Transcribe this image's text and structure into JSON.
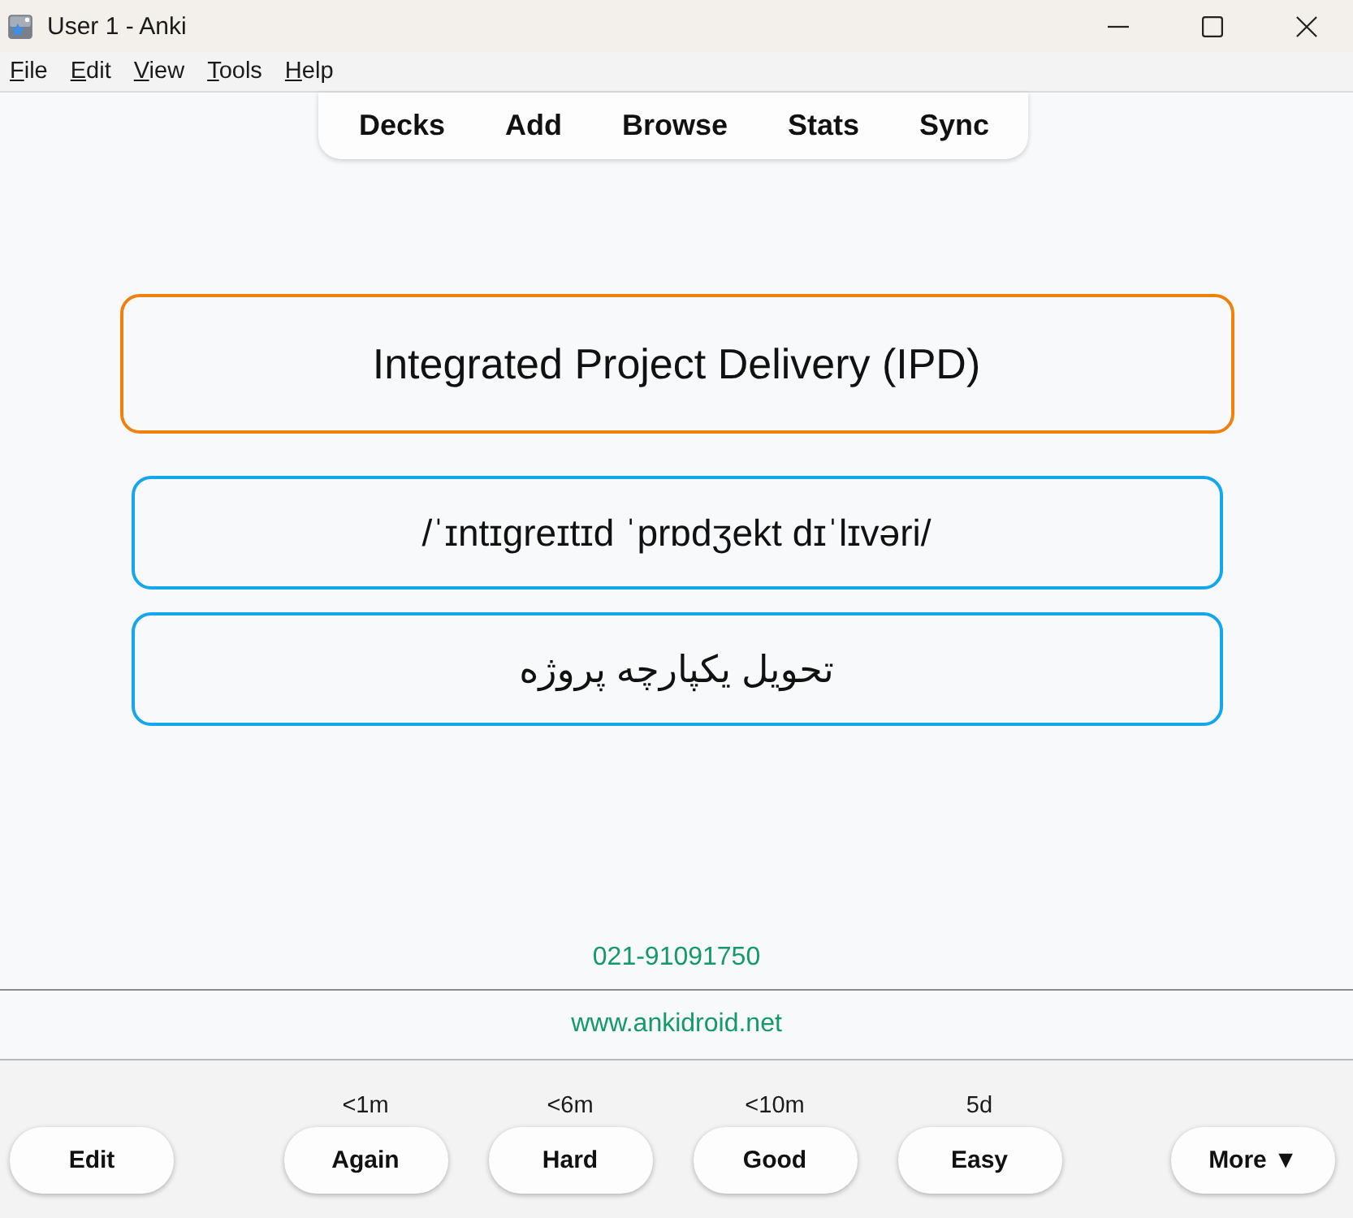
{
  "window": {
    "title": "User 1 - Anki"
  },
  "menu": [
    "File",
    "Edit",
    "View",
    "Tools",
    "Help"
  ],
  "toolbar": [
    "Decks",
    "Add",
    "Browse",
    "Stats",
    "Sync"
  ],
  "card_fields": [
    {
      "kind": "term",
      "text": "Integrated Project Delivery (IPD)"
    },
    {
      "kind": "pronunciation",
      "text": "/ˈɪntɪgreɪtɪd ˈprɒdʒekt dɪˈlɪvəri/"
    },
    {
      "kind": "translation",
      "text": "تحویل یکپارچه پروژه"
    }
  ],
  "footer": {
    "phone": "021-91091750",
    "website": "www.ankidroid.net"
  },
  "bottom_bar": {
    "edit_button": "Edit",
    "answer_buttons": [
      {
        "interval": "<1m",
        "label": "Again"
      },
      {
        "interval": "<6m",
        "label": "Hard"
      },
      {
        "interval": "<10m",
        "label": "Good"
      },
      {
        "interval": "5d",
        "label": "Easy"
      }
    ],
    "more_button": "More ▼"
  }
}
